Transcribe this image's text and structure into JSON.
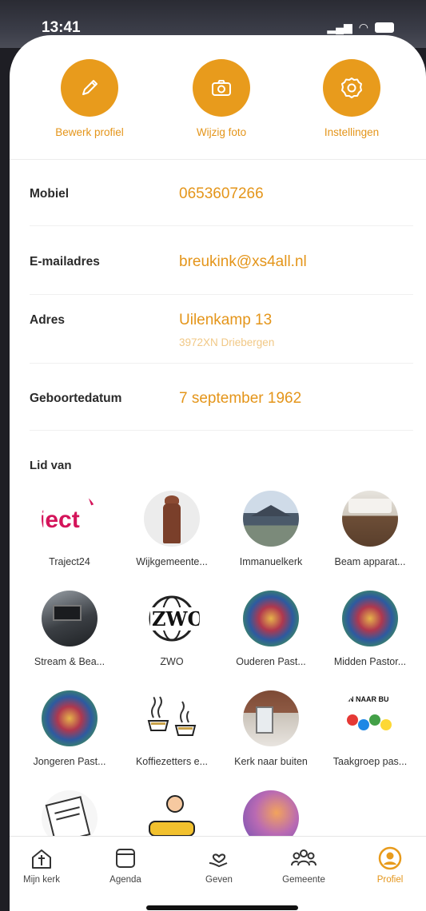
{
  "status": {
    "time": "13:41"
  },
  "actions": [
    {
      "label": "Bewerk profiel",
      "icon": "pencil-icon"
    },
    {
      "label": "Wijzig foto",
      "icon": "camera-icon"
    },
    {
      "label": "Instellingen",
      "icon": "gear-icon"
    }
  ],
  "profile": {
    "mobile": {
      "label": "Mobiel",
      "value": "0653607266"
    },
    "email": {
      "label": "E-mailadres",
      "value": "breukink@xs4all.nl"
    },
    "address": {
      "label": "Adres",
      "value": "Uilenkamp 13",
      "sub": "3972XN Driebergen"
    },
    "birthday": {
      "label": "Geboortedatum",
      "value": "7 september 1962"
    }
  },
  "groups": {
    "title": "Lid van",
    "items": [
      {
        "name": "Traject24",
        "logo_text": "iect"
      },
      {
        "name": "Wijkgemeente..."
      },
      {
        "name": "Immanuelkerk"
      },
      {
        "name": "Beam apparat..."
      },
      {
        "name": "Stream & Bea..."
      },
      {
        "name": "ZWO",
        "logo_text": "ZWO"
      },
      {
        "name": "Ouderen Past..."
      },
      {
        "name": "Midden Pastor..."
      },
      {
        "name": "Jongeren Past..."
      },
      {
        "name": "Koffiezetters e..."
      },
      {
        "name": "Kerk naar buiten"
      },
      {
        "name": "Taakgroep pas...",
        "logo_text": "EN NAAR BU"
      },
      {
        "name": ""
      },
      {
        "name": ""
      },
      {
        "name": ""
      }
    ]
  },
  "tabs": [
    {
      "label": "Mijn kerk",
      "icon": "church-icon"
    },
    {
      "label": "Agenda",
      "icon": "calendar-icon"
    },
    {
      "label": "Geven",
      "icon": "give-heart-icon"
    },
    {
      "label": "Gemeente",
      "icon": "people-icon"
    },
    {
      "label": "Profiel",
      "icon": "profile-icon",
      "active": true
    }
  ],
  "colors": {
    "accent": "#e89b1c"
  }
}
